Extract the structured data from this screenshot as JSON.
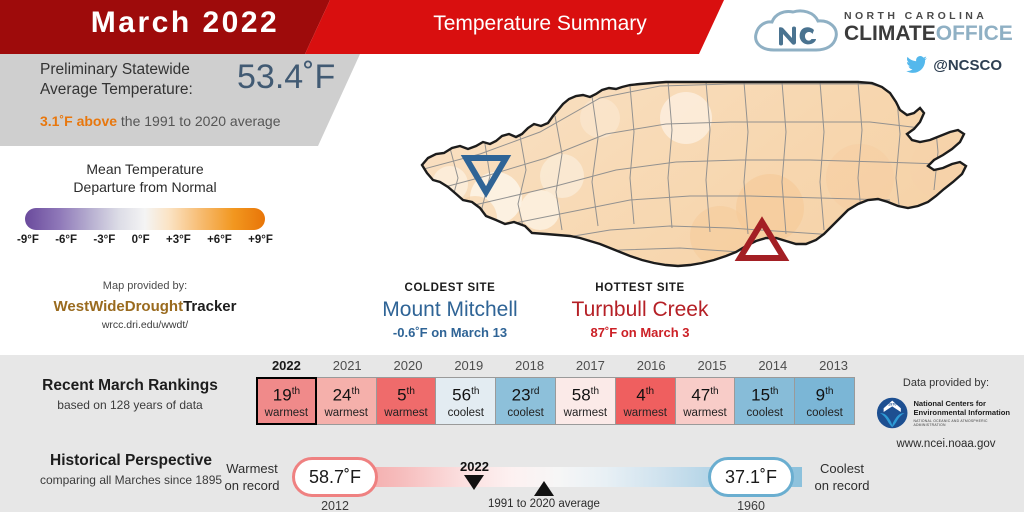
{
  "header": {
    "title": "March 2022",
    "subtitle": "Temperature Summary",
    "logo": {
      "line1": "NORTH CAROLINA",
      "line2_dark": "CLIMATE",
      "line2_light": "OFFICE",
      "twitter_handle": "@NCSCO",
      "cloud_icon": "nc-cloud-logo-icon",
      "bird_icon": "twitter-bird-icon"
    }
  },
  "stat_panel": {
    "label_line1": "Preliminary Statewide",
    "label_line2": "Average Temperature:",
    "value": "53.4˚F",
    "departure_highlight": "3.1˚F above",
    "departure_rest": " the 1991 to 2020 average",
    "highlight_color": "#e8770d",
    "value_color": "#415a73"
  },
  "legend": {
    "title_line1": "Mean Temperature",
    "title_line2": "Departure from Normal",
    "ticks": [
      "-9°F",
      "-6°F",
      "-3°F",
      "0°F",
      "+3°F",
      "+6°F",
      "+9°F"
    ],
    "cold_color": "#6a4a9c",
    "warm_color": "#e87508"
  },
  "map_credit": {
    "pre": "Map provided by:",
    "brand_part1": "WestWideDrought",
    "brand_part2": "Tracker",
    "url": "wrcc.dri.edu/wwdt/"
  },
  "sites": {
    "coldest": {
      "kicker": "COLDEST SITE",
      "name": "Mount Mitchell",
      "detail": "-0.6˚F on March 13",
      "marker_icon": "coldest-site-marker-triangle-down",
      "color": "#2f6496"
    },
    "hottest": {
      "kicker": "HOTTEST SITE",
      "name": "Turnbull Creek",
      "detail": "87˚F on March 3",
      "marker_icon": "hottest-site-marker-triangle-up",
      "color": "#b52026"
    }
  },
  "rankings": {
    "title": "Recent March Rankings",
    "subtitle": "based on 128 years of data",
    "items": [
      {
        "year": "2022",
        "rank": "19",
        "suffix": "th",
        "word": "warmest",
        "color": "#f08a8a",
        "current": true
      },
      {
        "year": "2021",
        "rank": "24",
        "suffix": "th",
        "word": "warmest",
        "color": "#f5b0ab",
        "current": false
      },
      {
        "year": "2020",
        "rank": "5",
        "suffix": "th",
        "word": "warmest",
        "color": "#ef6b6b",
        "current": false
      },
      {
        "year": "2019",
        "rank": "56",
        "suffix": "th",
        "word": "coolest",
        "color": "#e3ecf2",
        "current": false
      },
      {
        "year": "2018",
        "rank": "23",
        "suffix": "rd",
        "word": "coolest",
        "color": "#8dc0da",
        "current": false
      },
      {
        "year": "2017",
        "rank": "58",
        "suffix": "th",
        "word": "warmest",
        "color": "#fbeae8",
        "current": false
      },
      {
        "year": "2016",
        "rank": "4",
        "suffix": "th",
        "word": "warmest",
        "color": "#ef5f5f",
        "current": false
      },
      {
        "year": "2015",
        "rank": "47",
        "suffix": "th",
        "word": "warmest",
        "color": "#f8ccc8",
        "current": false
      },
      {
        "year": "2014",
        "rank": "15",
        "suffix": "th",
        "word": "coolest",
        "color": "#87bcd8",
        "current": false
      },
      {
        "year": "2013",
        "rank": "9",
        "suffix": "th",
        "word": "coolest",
        "color": "#7bb6d6",
        "current": false
      }
    ]
  },
  "historical": {
    "title": "Historical Perspective",
    "subtitle": "comparing all Marches since 1895",
    "warmest_end_label": "Warmest\non record",
    "warmest_value": "58.7˚F",
    "warmest_year": "2012",
    "coolest_end_label": "Coolest\non record",
    "coolest_value": "37.1˚F",
    "coolest_year": "1960",
    "current_marker_label": "2022",
    "normal_marker_label": "1991 to 2020 average",
    "warm_color": "#ef8181",
    "cool_color": "#6aaed0"
  },
  "noaa": {
    "pre": "Data provided by:",
    "line1": "National Centers for",
    "line2": "Environmental Information",
    "line3": "NATIONAL OCEANIC AND ATMOSPHERIC ADMINISTRATION",
    "url": "www.ncei.noaa.gov",
    "logo_icon": "noaa-seal-icon"
  }
}
